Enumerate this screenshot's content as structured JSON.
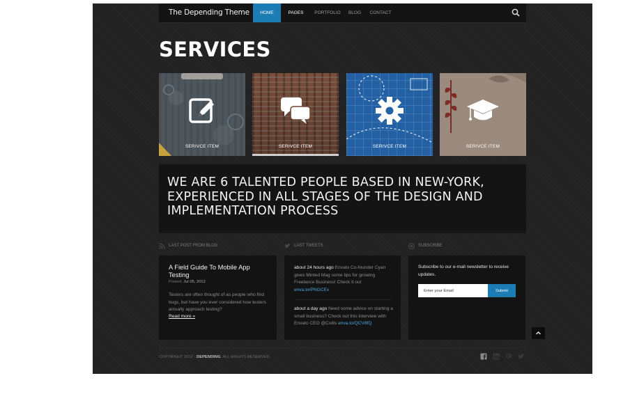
{
  "nav": {
    "brand": "The Depending Theme",
    "items": [
      {
        "label": "HOME"
      },
      {
        "label": "PAGES"
      },
      {
        "label": "PORTFOLIO"
      },
      {
        "label": "BLOG"
      },
      {
        "label": "CONTACT"
      }
    ],
    "active_color": "#1b7db4"
  },
  "page_title": "SERVICES",
  "services": [
    {
      "label": "SERIVCE ITEM",
      "icon": "edit-icon"
    },
    {
      "label": "SERIVCE ITEM",
      "icon": "chat-bubbles-icon"
    },
    {
      "label": "SERIVCE ITEM",
      "icon": "gear-icon"
    },
    {
      "label": "SERIVCE ITEM",
      "icon": "graduation-cap-icon"
    }
  ],
  "banner": "WE ARE 6 TALENTED PEOPLE BASED IN NEW-YORK, EXPERIENCED IN ALL STAGES OF THE DESIGN AND IMPLEMENTATION PROCESS",
  "blog": {
    "heading": "LAST POST FROM BLOG",
    "post_title": "A Field Guide To Mobile App Testing",
    "posted_label": "Posted:",
    "posted_date": "Jul 05, 2012",
    "body": "Testers are often thought of as people who find bugs, but have you ever considered how testers actually approach testing?",
    "read_more": "Read more »"
  },
  "tweets": {
    "heading": "LAST TWEETS",
    "items": [
      {
        "time": "about 24 hours ago",
        "text": " Envato Co-founder Cyan gives Minted Mag some tips for growing Freelance Business! Check it out ",
        "link": "enva.to/PNGCEx"
      },
      {
        "time": "about a day ago",
        "text": " Need some advice on starting a small business? Check out this interview with Envato CEO @Collis ",
        "link": "enva.to/QCV8fQ"
      }
    ]
  },
  "subscribe": {
    "heading": "SUBSCRIBE",
    "text": "Subscribe to our e-mail newsletter to receive updates.",
    "placeholder": "Enter your Email",
    "button": "Submit"
  },
  "footer": {
    "copyright_prefix": "COPYRIGHT 2012 - ",
    "brand": "DEPENDING",
    "copyright_suffix": ". ALL RIGHTS RESERVED.",
    "social": [
      "facebook-icon",
      "linkedin-icon",
      "pinterest-icon",
      "twitter-icon"
    ]
  }
}
